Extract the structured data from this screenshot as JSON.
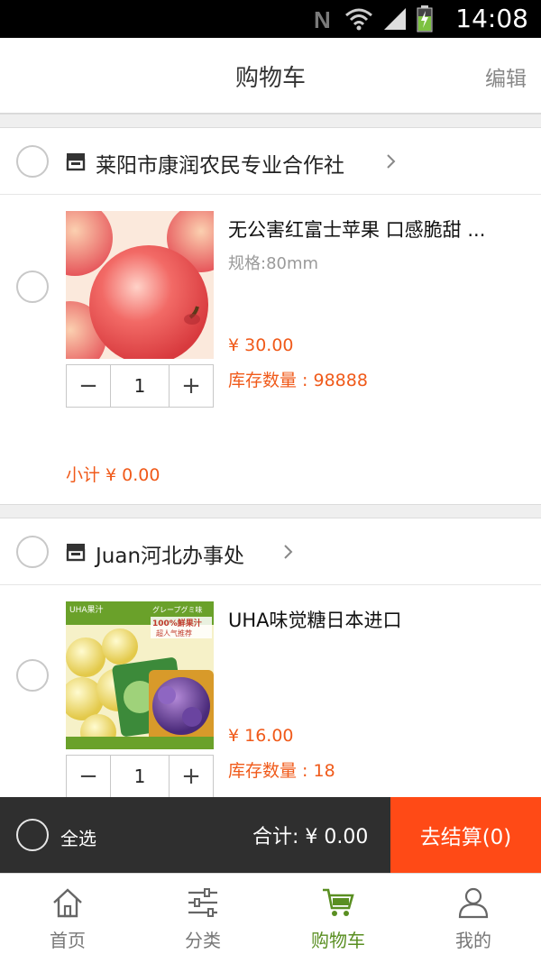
{
  "status_bar": {
    "time": "14:08"
  },
  "header": {
    "title": "购物车",
    "edit_label": "编辑"
  },
  "shops": [
    {
      "name": "莱阳市康润农民专业合作社",
      "items": [
        {
          "title": "无公害红富士苹果 口感脆甜 ...",
          "spec": "规格:80mm",
          "price": "¥ 30.00",
          "stock": "库存数量 : 98888",
          "quantity": "1"
        }
      ],
      "subtotal": "小计 ¥ 0.00"
    },
    {
      "name": "Juan河北办事处",
      "items": [
        {
          "title": "UHA味觉糖日本进口",
          "spec": "",
          "price": "¥ 16.00",
          "stock": "库存数量 : 18",
          "quantity": "1",
          "image_texts": [
            "UHA果汁",
            "グレープグミ味",
            "100%鮮果汁",
            "超人气推荐"
          ]
        }
      ]
    }
  ],
  "stepper": {
    "minus": "−",
    "plus": "+"
  },
  "summary": {
    "select_all_label": "全选",
    "total": "合计: ¥ 0.00",
    "checkout_label": "去结算(0)"
  },
  "tabs": [
    {
      "label": "首页",
      "icon": "home-icon"
    },
    {
      "label": "分类",
      "icon": "category-sliders-icon"
    },
    {
      "label": "购物车",
      "icon": "cart-icon",
      "active": true
    },
    {
      "label": "我的",
      "icon": "user-icon"
    }
  ],
  "colors": {
    "accent": "#f05a1a",
    "checkout": "#ff4a16",
    "tab_active": "#5a8f22",
    "bottom_bar": "#2f2f2f"
  }
}
